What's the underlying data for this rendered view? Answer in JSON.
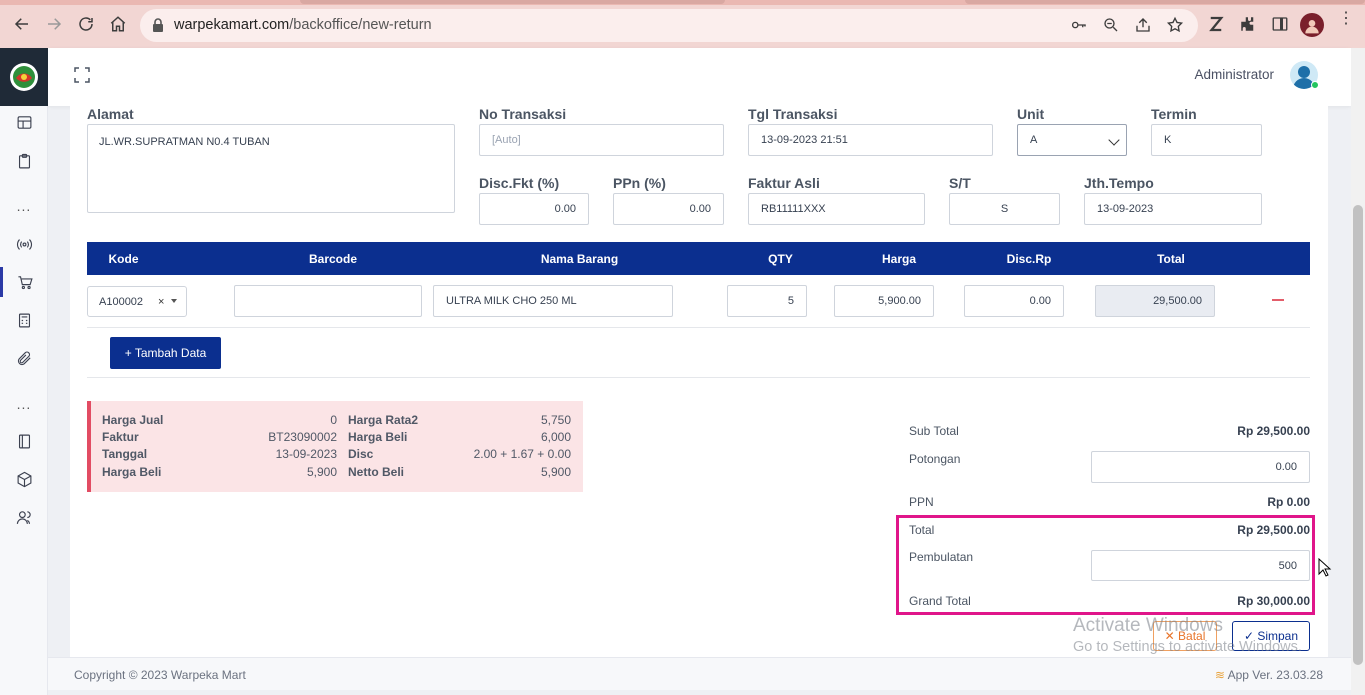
{
  "browser": {
    "url_host": "warpekamart.com",
    "url_path": "/backoffice/new-return"
  },
  "header": {
    "user_name": "Administrator"
  },
  "form": {
    "alamat_label": "Alamat",
    "alamat_value": "JL.WR.SUPRATMAN N0.4 TUBAN",
    "no_transaksi_label": "No Transaksi",
    "no_transaksi_placeholder": "[Auto]",
    "tgl_transaksi_label": "Tgl Transaksi",
    "tgl_transaksi_value": "13-09-2023 21:51",
    "unit_label": "Unit",
    "unit_value": "A",
    "termin_label": "Termin",
    "termin_value": "K",
    "disc_fkt_label": "Disc.Fkt (%)",
    "disc_fkt_value": "0.00",
    "ppn_label": "PPn (%)",
    "ppn_value": "0.00",
    "faktur_asli_label": "Faktur Asli",
    "faktur_asli_value": "RB11111XXX",
    "st_label": "S/T",
    "st_value": "S",
    "jth_tempo_label": "Jth.Tempo",
    "jth_tempo_value": "13-09-2023"
  },
  "table": {
    "headers": [
      "Kode",
      "Barcode",
      "Nama Barang",
      "QTY",
      "Harga",
      "Disc.Rp",
      "Total"
    ],
    "rows": [
      {
        "kode": "A100002",
        "barcode": "",
        "nama_barang": "ULTRA MILK CHO 250 ML",
        "qty": "5",
        "harga": "5,900.00",
        "disc_rp": "0.00",
        "total": "29,500.00"
      }
    ],
    "add_button": "+ Tambah Data"
  },
  "info": {
    "left": [
      {
        "k": "Harga Jual",
        "v": "0"
      },
      {
        "k": "Faktur",
        "v": "BT23090002"
      },
      {
        "k": "Tanggal",
        "v": "13-09-2023"
      },
      {
        "k": "Harga Beli",
        "v": "5,900"
      }
    ],
    "right": [
      {
        "k": "Harga Rata2",
        "v": "5,750"
      },
      {
        "k": "Harga Beli",
        "v": "6,000"
      },
      {
        "k": "Disc",
        "v": "2.00 + 1.67 + 0.00"
      },
      {
        "k": "Netto Beli",
        "v": "5,900"
      }
    ]
  },
  "totals": {
    "sub_total_label": "Sub Total",
    "sub_total_value": "Rp 29,500.00",
    "potongan_label": "Potongan",
    "potongan_value": "0.00",
    "ppn_label": "PPN",
    "ppn_value": "Rp 0.00",
    "total_label": "Total",
    "total_value": "Rp 29,500.00",
    "pembulatan_label": "Pembulatan",
    "pembulatan_value": "500",
    "grand_total_label": "Grand Total",
    "grand_total_value": "Rp 30,000.00"
  },
  "actions": {
    "batal": "✕ Batal",
    "simpan": "✓ Simpan"
  },
  "watermark": {
    "line1": "Activate Windows",
    "line2": "Go to Settings to activate Windows."
  },
  "footer": {
    "copyright": "Copyright © 2023 Warpeka Mart",
    "version": "App Ver. 23.03.28"
  },
  "colors": {
    "primary": "#0b2f8f",
    "highlight": "#e0158a",
    "info_bg": "#fbe4e6",
    "danger": "#e24c63"
  }
}
